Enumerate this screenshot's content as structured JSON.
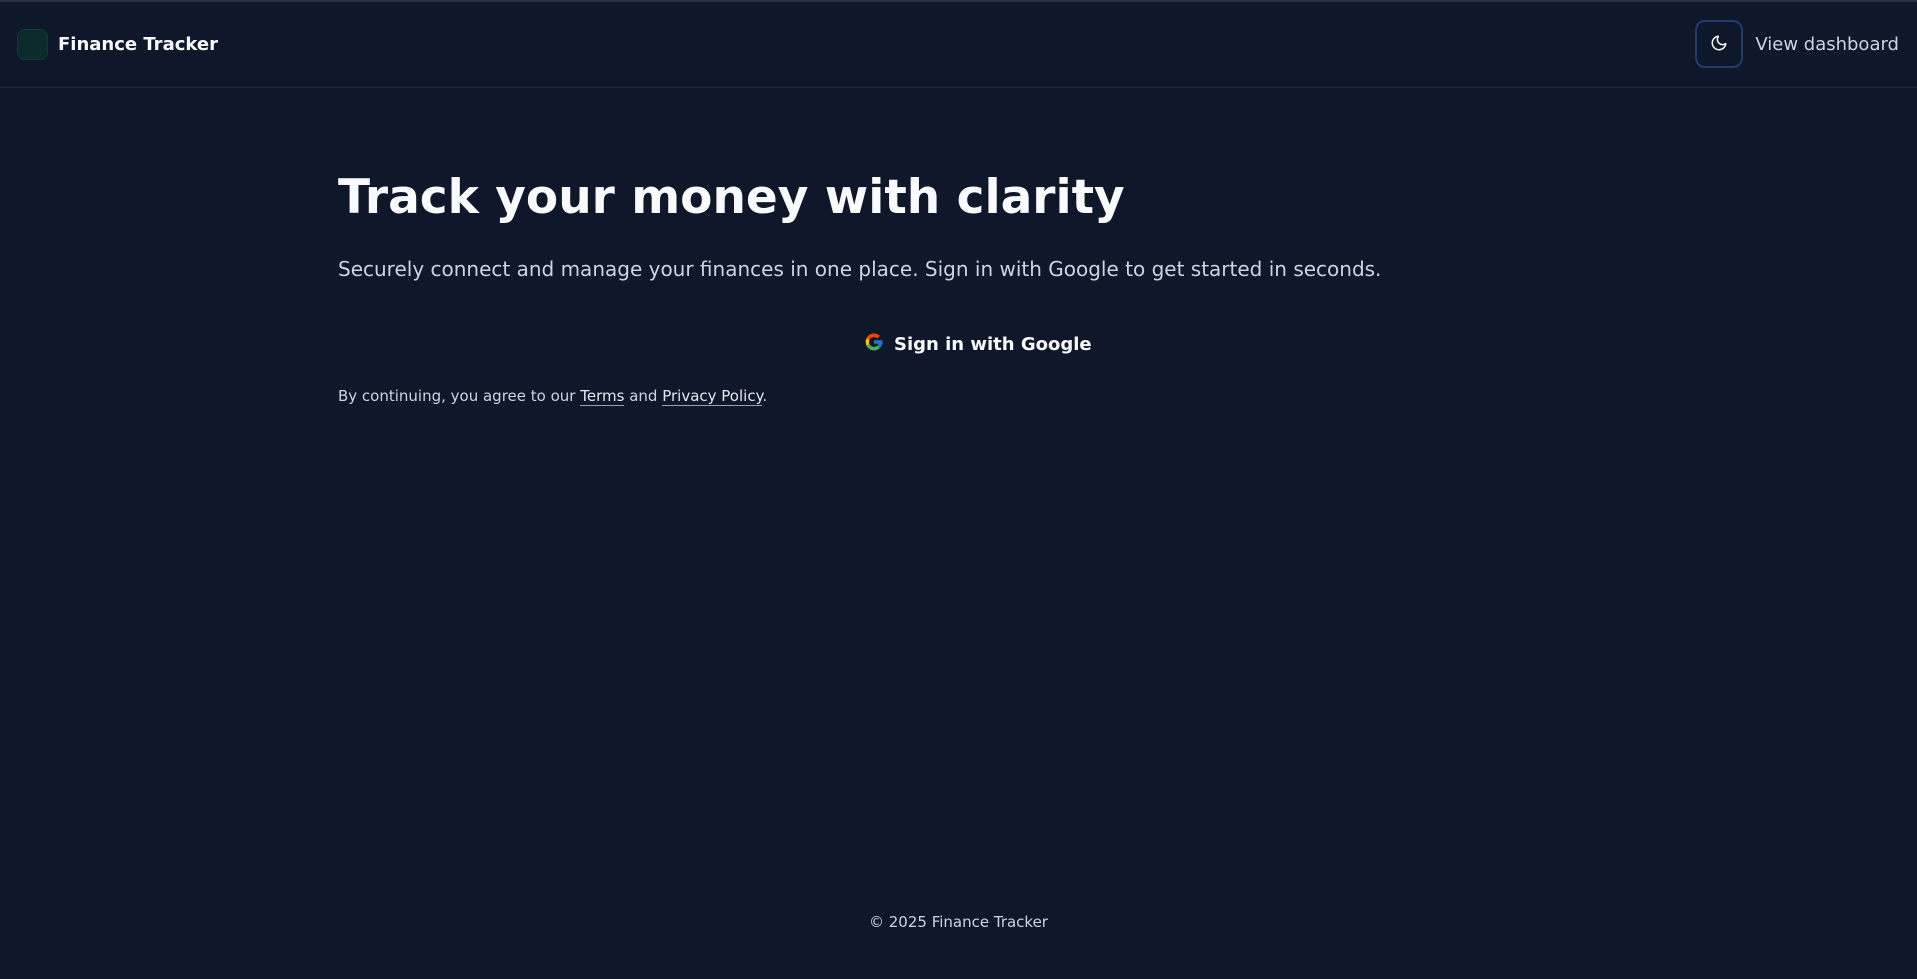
{
  "header": {
    "brand_name": "Finance Tracker",
    "dashboard_link": "View dashboard"
  },
  "hero": {
    "title": "Track your money with clarity",
    "subtitle": "Securely connect and manage your finances in one place. Sign in with Google to get started in seconds."
  },
  "auth": {
    "google_button": "Sign in with Google"
  },
  "legal": {
    "prefix": "By continuing, you agree to our",
    "terms": "Terms",
    "and": "and",
    "privacy": "Privacy Policy",
    "suffix": "."
  },
  "footer": {
    "copyright": "© 2025 Finance Tracker"
  },
  "icons": {
    "theme": "moon-icon",
    "google": "google-icon"
  },
  "colors": {
    "background": "#0f172a",
    "text": "#f8fafc",
    "muted_text": "#cbd5e1",
    "toggle_border": "#243b6b",
    "logo_bg": "#0b2a2a"
  }
}
